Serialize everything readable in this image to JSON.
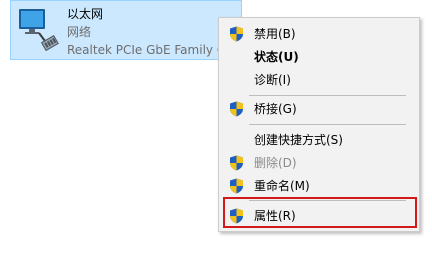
{
  "adapter": {
    "name": "以太网",
    "status": "网络",
    "device": "Realtek PCIe GbE Family C"
  },
  "menu": {
    "items": [
      {
        "label": "禁用(B)",
        "icon": "uac-shield-icon"
      },
      {
        "label": "状态(U)"
      },
      {
        "label": "诊断(I)"
      },
      {
        "label": "桥接(G)",
        "icon": "uac-shield-icon"
      },
      {
        "label": "创建快捷方式(S)"
      },
      {
        "label": "删除(D)",
        "icon": "uac-shield-icon"
      },
      {
        "label": "重命名(M)",
        "icon": "uac-shield-icon"
      },
      {
        "label": "属性(R)",
        "icon": "uac-shield-icon"
      }
    ]
  },
  "colors": {
    "selection_bg": "#cce8ff",
    "highlight_border": "#d21a1a",
    "menu_bg": "#f2f2f2"
  }
}
